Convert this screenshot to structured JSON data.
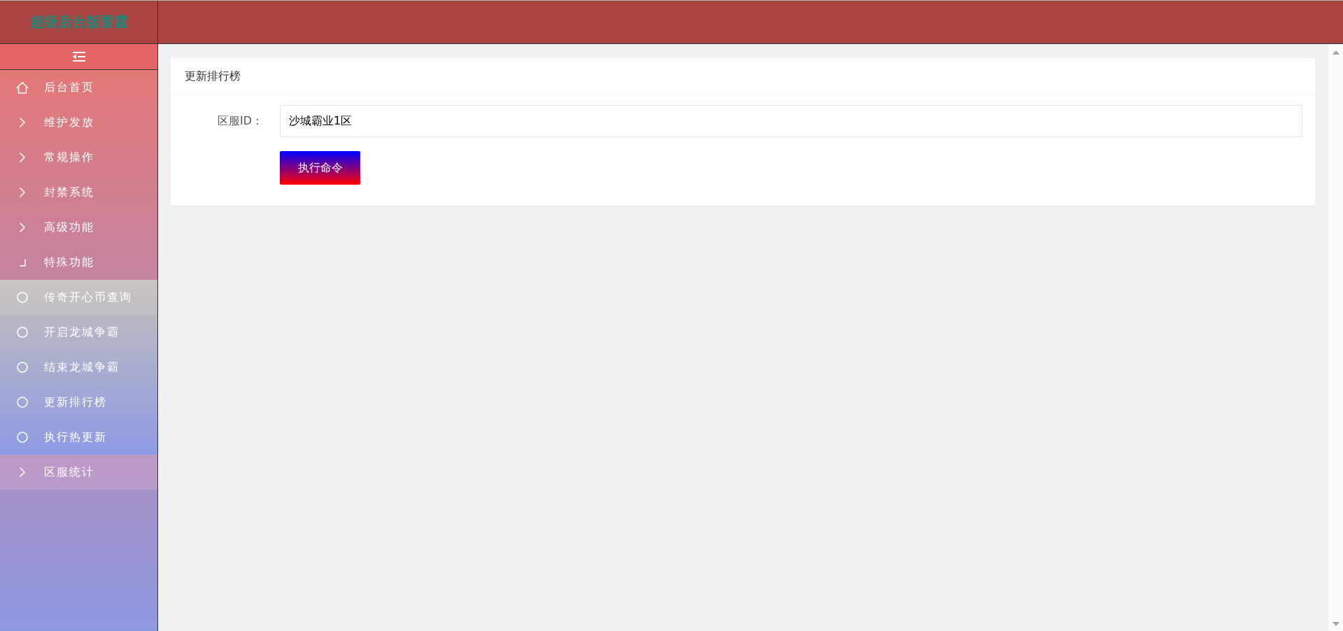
{
  "header": {
    "logo": "超级后台版雷霆"
  },
  "sidebar": {
    "items": [
      {
        "label": "后台首页",
        "kind": "home",
        "hovered": false
      },
      {
        "label": "维护发放",
        "kind": "group",
        "expanded": false,
        "hovered": false
      },
      {
        "label": "常规操作",
        "kind": "group",
        "expanded": false,
        "hovered": false
      },
      {
        "label": "封禁系统",
        "kind": "group",
        "expanded": false,
        "hovered": false
      },
      {
        "label": "高级功能",
        "kind": "group",
        "expanded": false,
        "hovered": false
      },
      {
        "label": "特殊功能",
        "kind": "group",
        "expanded": true,
        "hovered": false,
        "children": [
          {
            "label": "传奇开心币查询",
            "selected": true
          },
          {
            "label": "开启龙城争霸",
            "selected": false
          },
          {
            "label": "结束龙城争霸",
            "selected": false
          },
          {
            "label": "更新排行榜",
            "selected": false
          },
          {
            "label": "执行热更新",
            "selected": false
          }
        ]
      },
      {
        "label": "区服统计",
        "kind": "group",
        "expanded": false,
        "hovered": true
      }
    ]
  },
  "card": {
    "title": "更新排行榜",
    "fields": [
      {
        "label": "区服ID：",
        "value": "沙城霸业1区"
      }
    ],
    "submit": "执行命令"
  }
}
